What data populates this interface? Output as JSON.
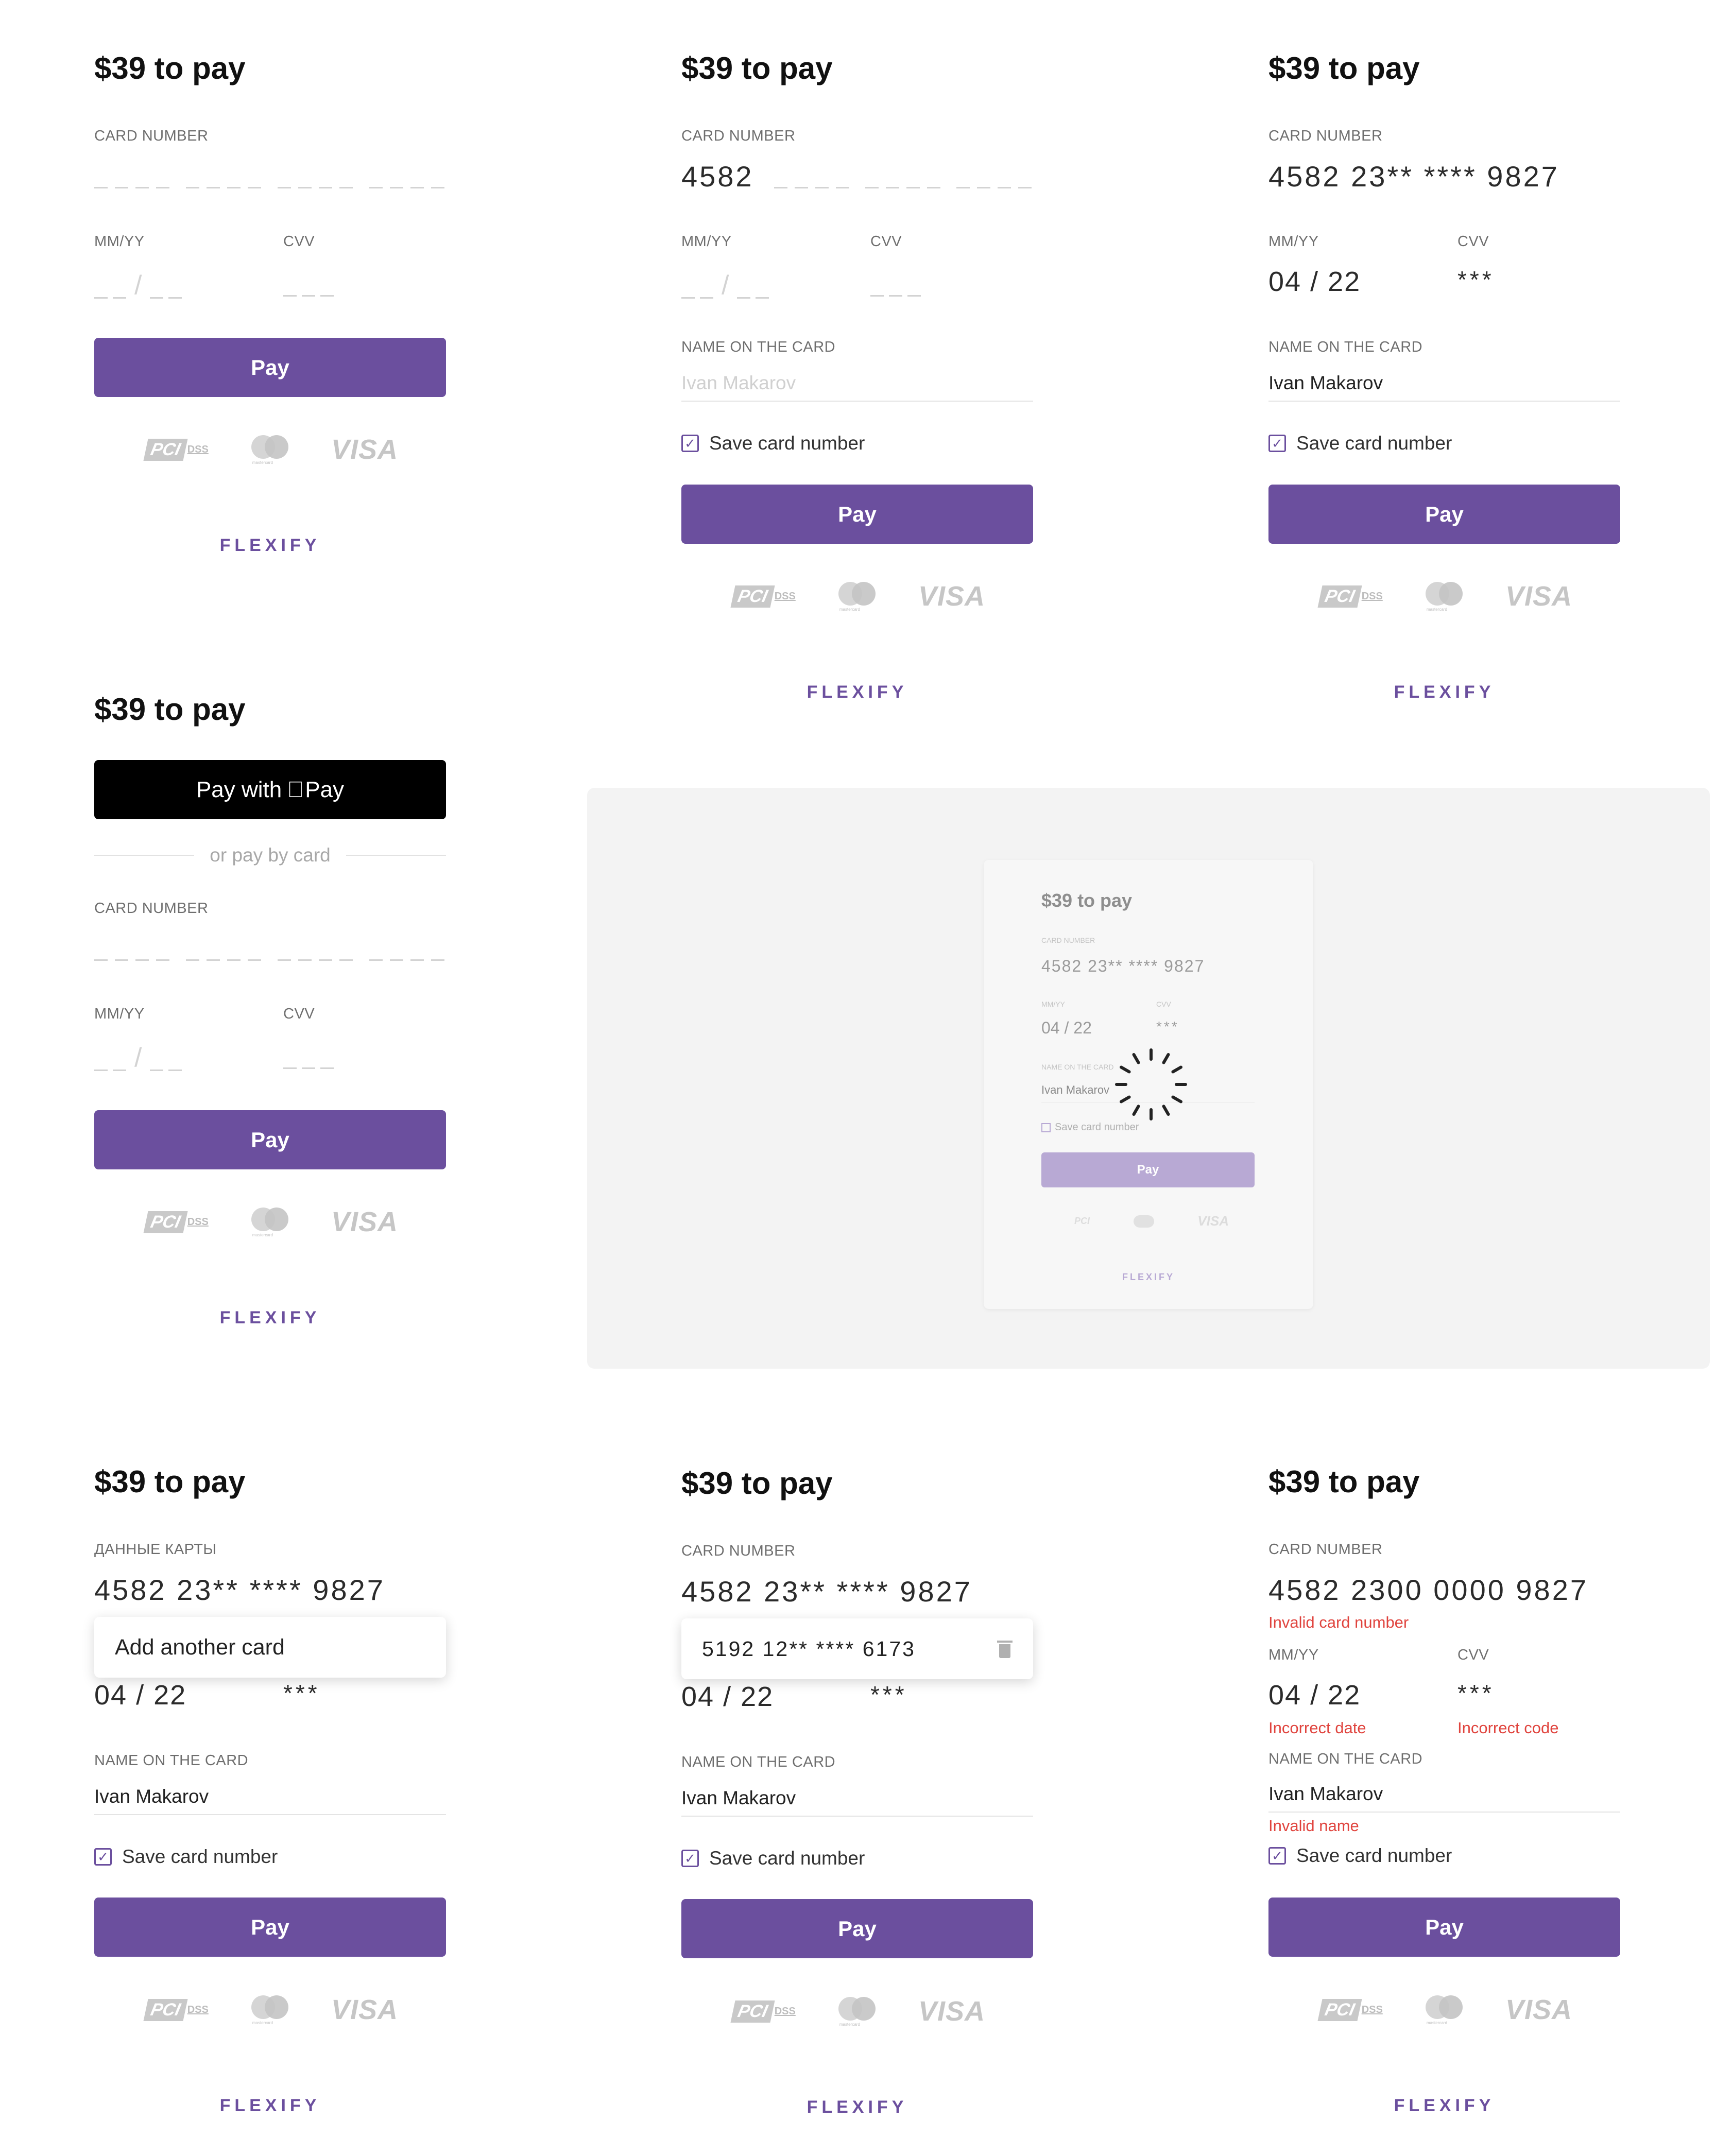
{
  "title": "$39 to pay",
  "labels": {
    "card_number": "CARD NUMBER",
    "card_number_ru": "ДАННЫЕ КАРТЫ",
    "expiry": "MM/YY",
    "cvv": "CVV",
    "name_on_card": "NAME ON THE CARD",
    "save_card": "Save card number"
  },
  "buttons": {
    "pay": "Pay",
    "apple_pay_prefix": "Pay with",
    "apple_pay_suffix": "Pay"
  },
  "divider_text": "or pay by card",
  "brand": "FLEXIFY",
  "payment_logos": {
    "pci": "PCI",
    "dss": "DSS",
    "mastercard": "mastercard",
    "visa": "VISA"
  },
  "values": {
    "card_partial": "4582",
    "card_masked": "4582  23**  ****  9827",
    "card_full_invalid": "4582  2300 0000  9827",
    "expiry": "04 / 22",
    "cvv_masked": "***",
    "name": "Ivan Makarov",
    "name_placeholder": "Ivan Makarov"
  },
  "dropdown": {
    "add_another": "Add another card",
    "saved_card": "5192  12**  ****  6173"
  },
  "errors": {
    "card": "Invalid card number",
    "date": "Incorrect date",
    "code": "Incorrect code",
    "name": "Invalid name"
  },
  "colors": {
    "accent": "#6b4f9e",
    "error": "#e0443e",
    "apple_pay": "#000000",
    "disabled_pay": "#b8a9d4"
  }
}
